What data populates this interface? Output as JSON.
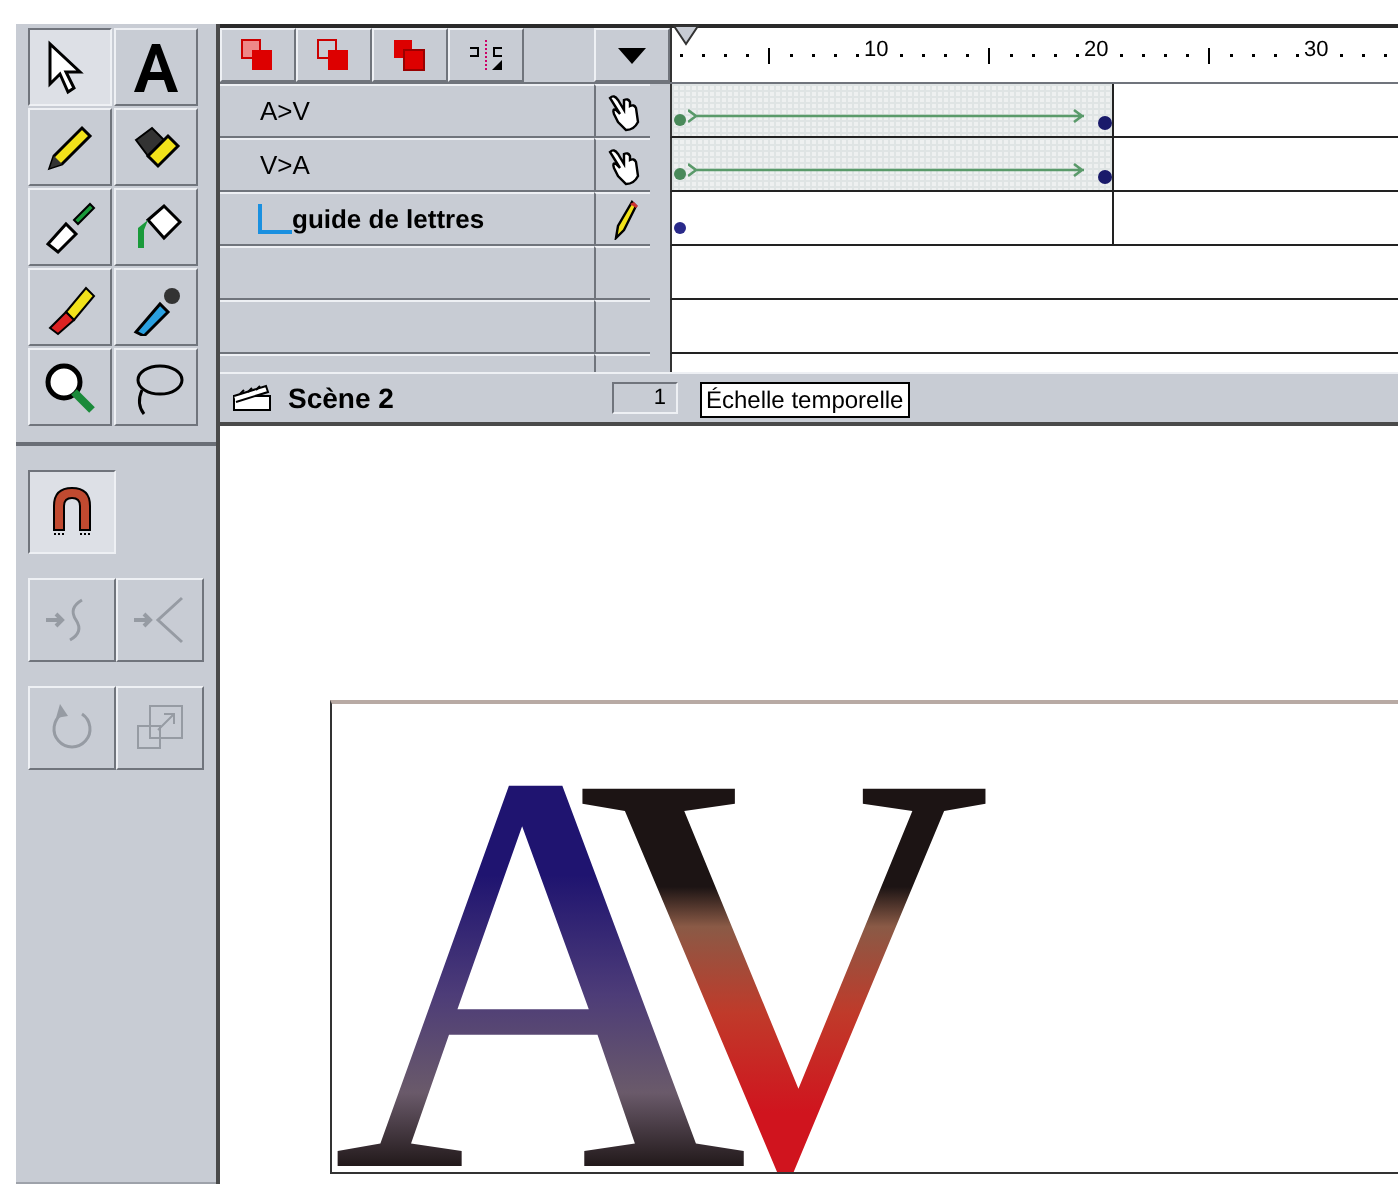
{
  "tools": [
    {
      "kind": "arrow",
      "selected": true
    },
    {
      "kind": "text",
      "selected": false
    },
    {
      "kind": "pencil",
      "selected": false
    },
    {
      "kind": "ink",
      "selected": false
    },
    {
      "kind": "brush",
      "selected": false
    },
    {
      "kind": "bucket",
      "selected": false
    },
    {
      "kind": "eraser",
      "selected": false
    },
    {
      "kind": "dropper",
      "selected": false
    },
    {
      "kind": "magnifier",
      "selected": false
    },
    {
      "kind": "lasso",
      "selected": false
    }
  ],
  "modifiers": [
    [
      {
        "kind": "magnet",
        "selected": true,
        "disabled": false
      }
    ],
    [
      {
        "kind": "smooth",
        "selected": false,
        "disabled": true
      },
      {
        "kind": "straighten",
        "selected": false,
        "disabled": true
      }
    ],
    [
      {
        "kind": "rotate",
        "selected": false,
        "disabled": true
      },
      {
        "kind": "scale",
        "selected": false,
        "disabled": true
      }
    ]
  ],
  "timeline": {
    "buttons": [
      {
        "kind": "onion"
      },
      {
        "kind": "onion-outline"
      },
      {
        "kind": "edit-multiple"
      },
      {
        "kind": "markers"
      }
    ],
    "ruler_labels": [
      "10",
      "20",
      "30"
    ],
    "layers": [
      {
        "name": "A>V",
        "guide": false,
        "selected": false,
        "tween": true
      },
      {
        "name": "V>A",
        "guide": false,
        "selected": false,
        "tween": true
      },
      {
        "name": "guide de lettres",
        "guide": true,
        "selected": true,
        "tween": false
      }
    ],
    "scene": "Scène 2",
    "frame": "1",
    "tooltip": "Échelle temporelle"
  },
  "stage": {
    "text": "AV"
  }
}
